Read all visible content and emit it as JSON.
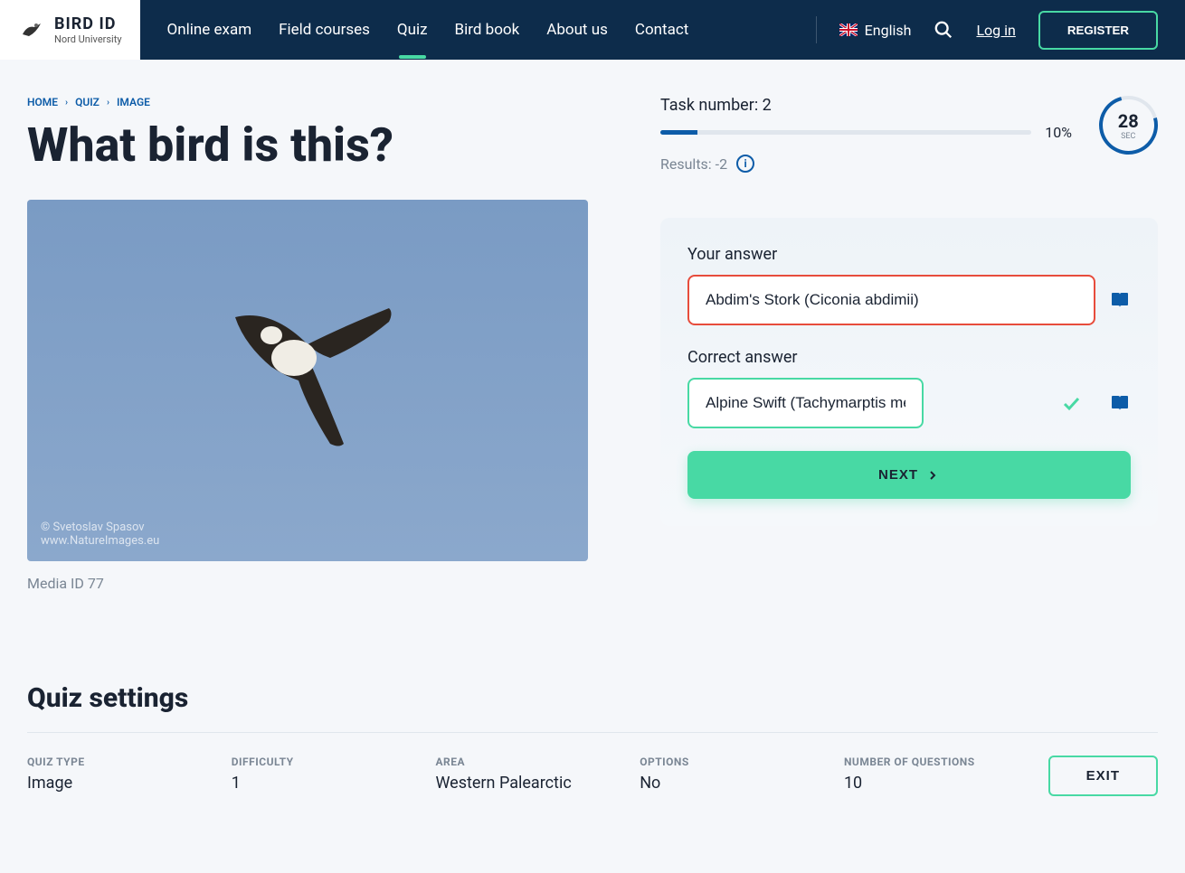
{
  "logo": {
    "title": "BIRD ID",
    "subtitle": "Nord University"
  },
  "nav": {
    "items": [
      "Online exam",
      "Field courses",
      "Quiz",
      "Bird book",
      "About us",
      "Contact"
    ],
    "language": "English",
    "login": "Log in",
    "register": "REGISTER"
  },
  "breadcrumb": {
    "items": [
      "HOME",
      "QUIZ",
      "IMAGE"
    ]
  },
  "page_title": "What bird is this?",
  "task": {
    "number_label": "Task number: 2",
    "progress_pct": "10%",
    "results_label": "Results: -2"
  },
  "timer": {
    "value": "28",
    "unit": "SEC"
  },
  "media_id": "Media ID 77",
  "image": {
    "watermark_line1": "© Svetoslav Spasov",
    "watermark_line2": "www.NatureImages.eu"
  },
  "answer_panel": {
    "your_answer_label": "Your answer",
    "your_answer_value": "Abdim's Stork (Ciconia abdimii)",
    "correct_answer_label": "Correct answer",
    "correct_answer_value": "Alpine Swift (Tachymarptis melba)",
    "next_label": "NEXT"
  },
  "settings": {
    "title": "Quiz settings",
    "items": [
      {
        "label": "QUIZ TYPE",
        "value": "Image"
      },
      {
        "label": "DIFFICULTY",
        "value": "1"
      },
      {
        "label": "AREA",
        "value": "Western Palearctic"
      },
      {
        "label": "OPTIONS",
        "value": "No"
      },
      {
        "label": "NUMBER OF QUESTIONS",
        "value": "10"
      }
    ],
    "exit_label": "EXIT"
  }
}
